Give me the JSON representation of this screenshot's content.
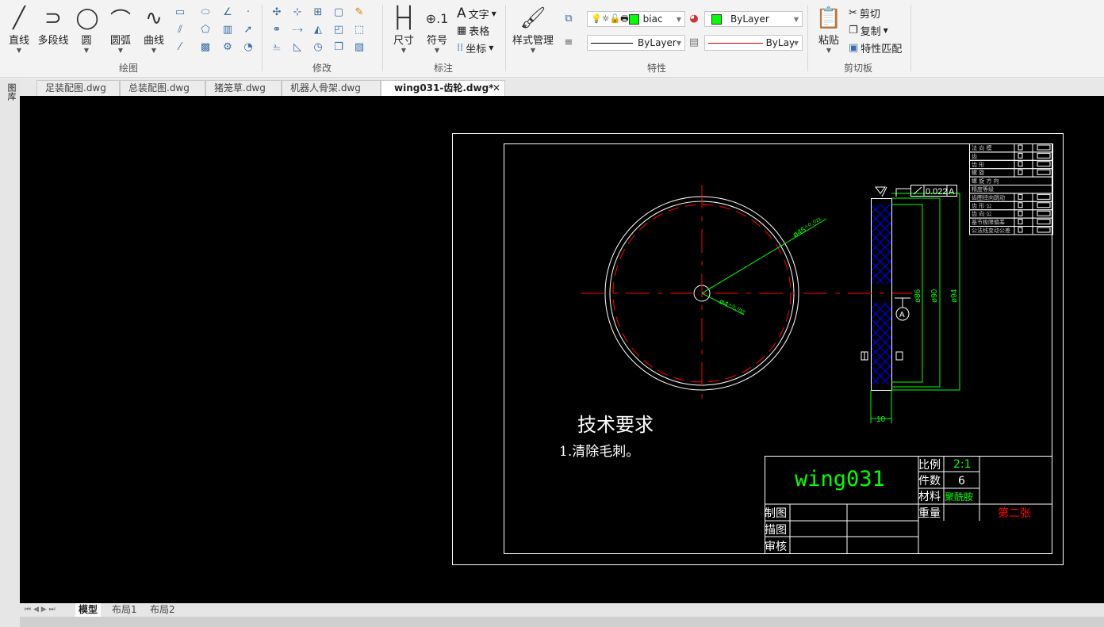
{
  "ribbon": {
    "draw": {
      "label": "绘图",
      "tools": [
        "直线",
        "多段线",
        "圆",
        "圆弧",
        "曲线"
      ]
    },
    "modify": {
      "label": "修改"
    },
    "annotate": {
      "label": "标注",
      "dimension": "尺寸",
      "symbol": "符号",
      "text": "文字",
      "table": "表格",
      "coordinate": "坐标"
    },
    "properties": {
      "label": "特性",
      "style_manager": "样式管理",
      "layer": "biac",
      "color": "ByLayer",
      "linetype": "ByLayer",
      "lineweight": "ByLayе",
      "color_value": "#00ff00"
    },
    "clipboard": {
      "label": "剪切板",
      "paste": "粘贴",
      "cut": "剪切",
      "copy": "复制",
      "match": "特性匹配"
    }
  },
  "doc_tabs": [
    {
      "label": "足装配图.dwg"
    },
    {
      "label": "总装配图.dwg"
    },
    {
      "label": "猪笼草.dwg"
    },
    {
      "label": "机器人骨架.dwg"
    },
    {
      "label": "wing031-齿轮.dwg*",
      "active": true
    }
  ],
  "side_panel_label": "图库",
  "layout_tabs": [
    {
      "label": "模型",
      "active": true
    },
    {
      "label": "布局1"
    },
    {
      "label": "布局2"
    }
  ],
  "drawing": {
    "tech_title": "技术要求",
    "tech_item": "1.清除毛刺。",
    "dim_outer": "ø45⁺⁰·⁰²¹",
    "dim_inner": "ø4⁺⁰·⁰¹²",
    "dim_86": "ø86",
    "dim_90": "ø90",
    "dim_94": "ø94",
    "dim_width": "10",
    "tolerance": "0.022",
    "datum": "A",
    "tol_table": [
      "法 向 模",
      "齿",
      "齿 形",
      "螺 旋",
      "螺 旋 方 向",
      "精度等级",
      "齿圈径向跳动",
      "齿 形 公",
      "齿 向 公",
      "基节极限偏差",
      "公法线变动公差"
    ],
    "title_block": {
      "name": "wing031",
      "scale_label": "比例",
      "scale": "2:1",
      "count_label": "件数",
      "count": "6",
      "material_label": "材料",
      "material": "聚酰胺",
      "weight_label": "重量",
      "sheet": "第二张",
      "drawn": "制图",
      "traced": "描图",
      "checked": "审核"
    },
    "colors": {
      "centerline": "#ff0000",
      "dimension": "#00ff00",
      "hatch": "#0000ff",
      "outline": "#ffffff"
    }
  }
}
